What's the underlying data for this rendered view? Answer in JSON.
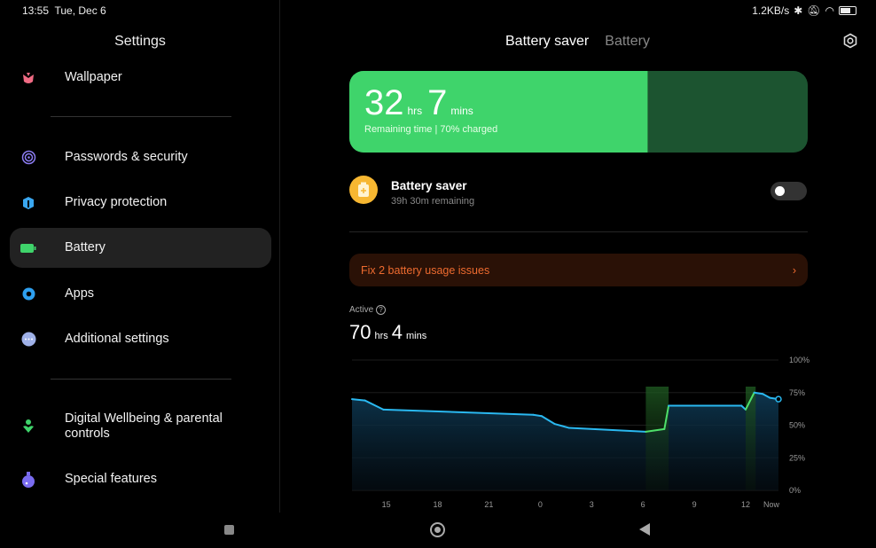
{
  "status_bar": {
    "time": "13:55",
    "date": "Tue, Dec 6",
    "network_speed": "1.2KB/s",
    "icons": [
      "bluetooth-icon",
      "mute-icon",
      "wifi-icon",
      "battery-icon"
    ]
  },
  "sidebar": {
    "title": "Settings",
    "items": [
      {
        "label": "Wallpaper",
        "icon": "wallpaper-icon",
        "color": "#f06b84"
      },
      {
        "label": "Passwords & security",
        "icon": "fingerprint-icon",
        "color": "#8b7cf0"
      },
      {
        "label": "Privacy protection",
        "icon": "privacy-icon",
        "color": "#3aa7f0"
      },
      {
        "label": "Battery",
        "icon": "battery-icon",
        "color": "#3fd46b",
        "active": true
      },
      {
        "label": "Apps",
        "icon": "gear-icon",
        "color": "#2ea0f0"
      },
      {
        "label": "Additional settings",
        "icon": "more-icon",
        "color": "#9fb1e8"
      },
      {
        "label": "Digital Wellbeing & parental controls",
        "icon": "wellbeing-icon",
        "color": "#3fd46b"
      },
      {
        "label": "Special features",
        "icon": "potion-icon",
        "color": "#7a6cf0"
      }
    ]
  },
  "header": {
    "tabs": [
      {
        "label": "Battery saver",
        "active": true
      },
      {
        "label": "Battery",
        "active": false
      }
    ],
    "settings_icon": "gear-icon"
  },
  "remaining": {
    "hours": "32",
    "hrs_unit": "hrs",
    "minutes": "7",
    "mins_unit": "mins",
    "subtitle": "Remaining time | 70% charged",
    "charge_percent": 70
  },
  "battery_saver": {
    "title": "Battery saver",
    "subtitle": "39h 30m remaining",
    "enabled": false
  },
  "issues": {
    "label": "Fix 2 battery usage issues"
  },
  "active": {
    "label": "Active",
    "hours": "70",
    "hrs_unit": "hrs",
    "minutes": "4",
    "mins_unit": "mins"
  },
  "chart_data": {
    "type": "area",
    "x_tick_labels": [
      "15",
      "18",
      "21",
      "0",
      "3",
      "6",
      "9",
      "12",
      "Now"
    ],
    "y_tick_labels": [
      "100%",
      "75%",
      "50%",
      "25%",
      "0%"
    ],
    "ylim": [
      0,
      100
    ],
    "xlim": [
      "13:00",
      "13:55"
    ],
    "grid": true,
    "points": [
      [
        "13:00",
        70
      ],
      [
        "13:45",
        69
      ],
      [
        "14:50",
        62
      ],
      [
        "23:35",
        58
      ],
      [
        "00:05",
        57
      ],
      [
        "00:50",
        51
      ],
      [
        "01:40",
        48
      ],
      [
        "06:10",
        45
      ],
      [
        "07:15",
        47
      ],
      [
        "07:30",
        65
      ],
      [
        "11:45",
        65
      ],
      [
        "12:00",
        62
      ],
      [
        "12:30",
        75
      ],
      [
        "13:00",
        74
      ],
      [
        "13:25",
        71
      ],
      [
        "13:55",
        70
      ]
    ],
    "charging_intervals": [
      [
        "06:10",
        "07:30"
      ],
      [
        "12:00",
        "12:35"
      ]
    ],
    "colors": {
      "line": "#2ab8f0",
      "charging": "#4ee06a"
    }
  }
}
